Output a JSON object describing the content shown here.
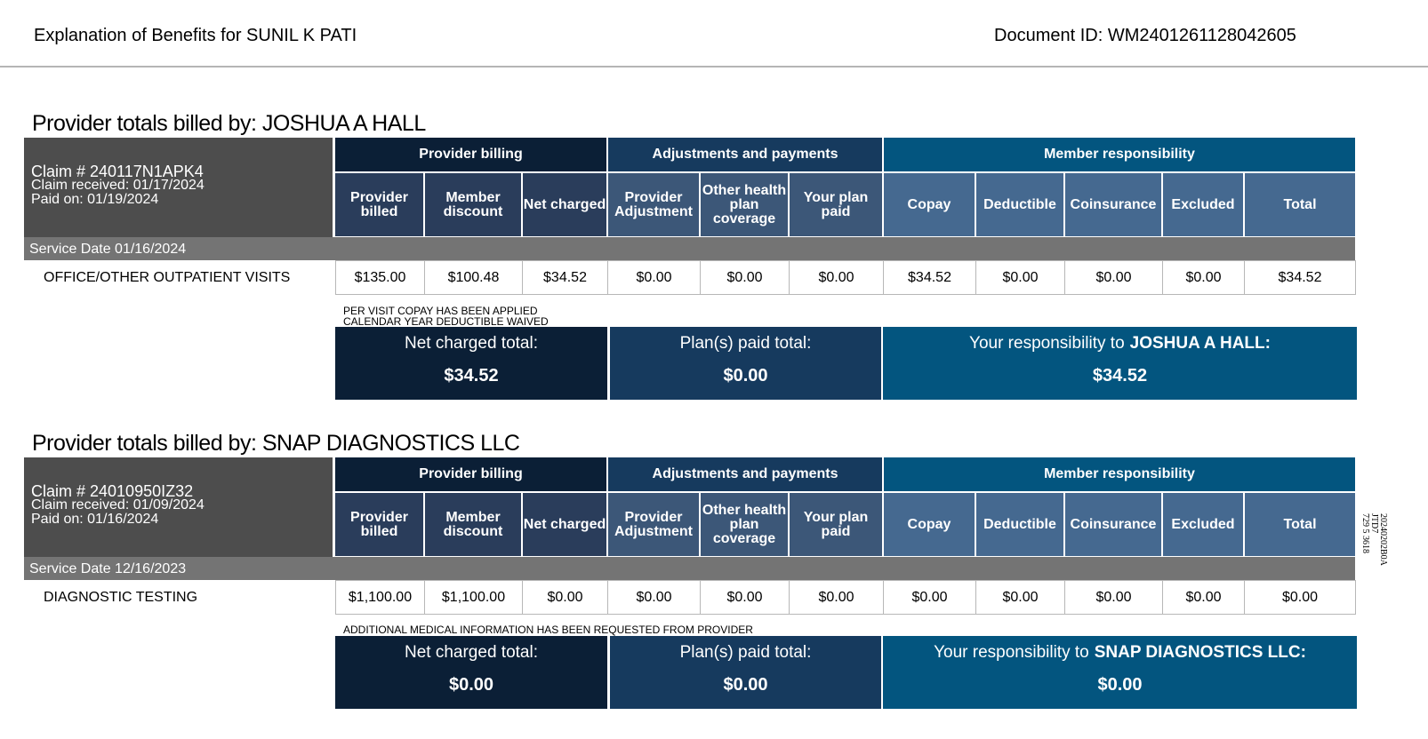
{
  "header": {
    "title": "Explanation of Benefits for SUNIL K PATI",
    "document_id": "Document ID: WM2401261128042605"
  },
  "column_groups": {
    "provider_billing": "Provider billing",
    "adjustments": "Adjustments and payments",
    "member_responsibility": "Member responsibility"
  },
  "columns": {
    "provider_billed": "Provider billed",
    "member_discount": "Member discount",
    "net_charged": "Net charged",
    "provider_adjustment": "Provider Adjustment",
    "other_coverage": "Other health plan coverage",
    "your_plan_paid": "Your plan paid",
    "copay": "Copay",
    "deductible": "Deductible",
    "coinsurance": "Coinsurance",
    "excluded": "Excluded",
    "total": "Total"
  },
  "totals_labels": {
    "net_charged_total": "Net charged total:",
    "plan_paid_total": "Plan(s) paid total:",
    "your_responsibility": "Your responsibility to"
  },
  "claims": [
    {
      "section_title": "Provider totals billed by: JOSHUA A HALL",
      "claim_number": "Claim # 240117N1APK4",
      "claim_received": "Claim received: 01/17/2024",
      "paid_on": "Paid on: 01/19/2024",
      "service_date": "Service Date 01/16/2024",
      "service": "OFFICE/OTHER OUTPATIENT VISITS",
      "values": {
        "provider_billed": "$135.00",
        "member_discount": "$100.48",
        "net_charged": "$34.52",
        "provider_adjustment": "$0.00",
        "other_coverage": "$0.00",
        "your_plan_paid": "$0.00",
        "copay": "$34.52",
        "deductible": "$0.00",
        "coinsurance": "$0.00",
        "excluded": "$0.00",
        "total": "$34.52"
      },
      "notes": [
        "PER VISIT COPAY HAS BEEN APPLIED",
        "CALENDAR YEAR DEDUCTIBLE WAIVED"
      ],
      "provider_name": "JOSHUA A HALL:",
      "net_charged_total": "$34.52",
      "plan_paid_total": "$0.00",
      "your_responsibility": "$34.52"
    },
    {
      "section_title": "Provider totals billed by: SNAP DIAGNOSTICS LLC",
      "claim_number": "Claim # 24010950IZ32",
      "claim_received": "Claim received: 01/09/2024",
      "paid_on": "Paid on: 01/16/2024",
      "service_date": "Service Date 12/16/2023",
      "service": "DIAGNOSTIC TESTING",
      "values": {
        "provider_billed": "$1,100.00",
        "member_discount": "$1,100.00",
        "net_charged": "$0.00",
        "provider_adjustment": "$0.00",
        "other_coverage": "$0.00",
        "your_plan_paid": "$0.00",
        "copay": "$0.00",
        "deductible": "$0.00",
        "coinsurance": "$0.00",
        "excluded": "$0.00",
        "total": "$0.00"
      },
      "notes": [
        "ADDITIONAL MEDICAL INFORMATION HAS BEEN REQUESTED FROM PROVIDER"
      ],
      "provider_name": "SNAP DIAGNOSTICS LLC:",
      "net_charged_total": "$0.00",
      "plan_paid_total": "$0.00",
      "your_responsibility": "$0.00"
    }
  ],
  "side_code": [
    "20240202B0A",
    "JTD7",
    "729 5 3618"
  ]
}
